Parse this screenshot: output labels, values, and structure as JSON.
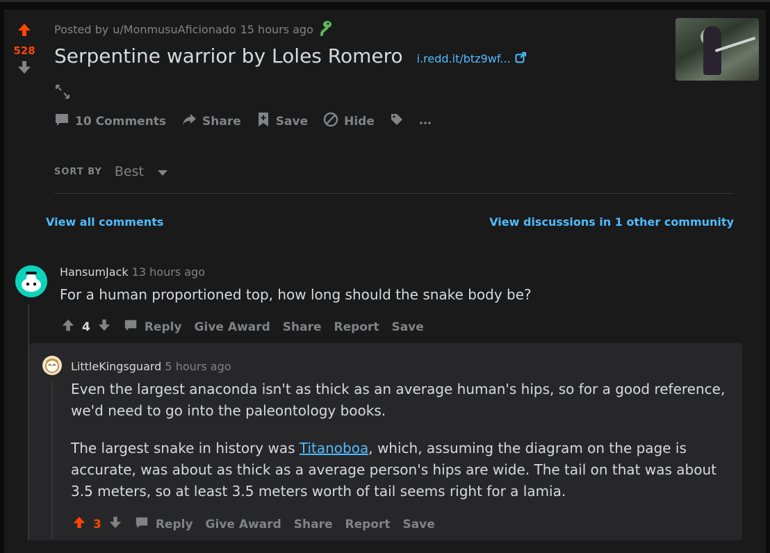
{
  "post": {
    "score": "528",
    "meta_prefix": "Posted by",
    "author": "u/MonmusuAficionado",
    "time": "15 hours ago",
    "title": "Serpentine warrior by Loles Romero",
    "link_text": "i.redd.it/btz9wf...",
    "actions": {
      "comments": "10 Comments",
      "share": "Share",
      "save": "Save",
      "hide": "Hide"
    }
  },
  "sort": {
    "label": "SORT BY",
    "value": "Best"
  },
  "view_all": "View all comments",
  "view_discussions": "View discussions in 1 other community",
  "comments": [
    {
      "author": "HansumJack",
      "time": "13 hours ago",
      "body": "For a human proportioned top, how long should the snake body be?",
      "score": "4",
      "actions": {
        "reply": "Reply",
        "award": "Give Award",
        "share": "Share",
        "report": "Report",
        "save": "Save"
      }
    },
    {
      "author": "LittleKingsguard",
      "time": "5 hours ago",
      "para1": "Even the largest anaconda isn't as thick as an average human's hips, so for a good reference, we'd need to go into the paleontology books.",
      "para2_before": "The largest snake in history was ",
      "para2_link": "Titanoboa",
      "para2_after": ", which, assuming the diagram on the page is accurate, was about as thick as a average person's hips are wide. The tail on that was about 3.5 meters, so at least 3.5 meters worth of tail seems right for a lamia.",
      "score": "3",
      "actions": {
        "reply": "Reply",
        "award": "Give Award",
        "share": "Share",
        "report": "Report",
        "save": "Save"
      }
    }
  ],
  "colors": {
    "upvote": "#ff4500",
    "link": "#4fbcff",
    "muted": "#818384"
  }
}
